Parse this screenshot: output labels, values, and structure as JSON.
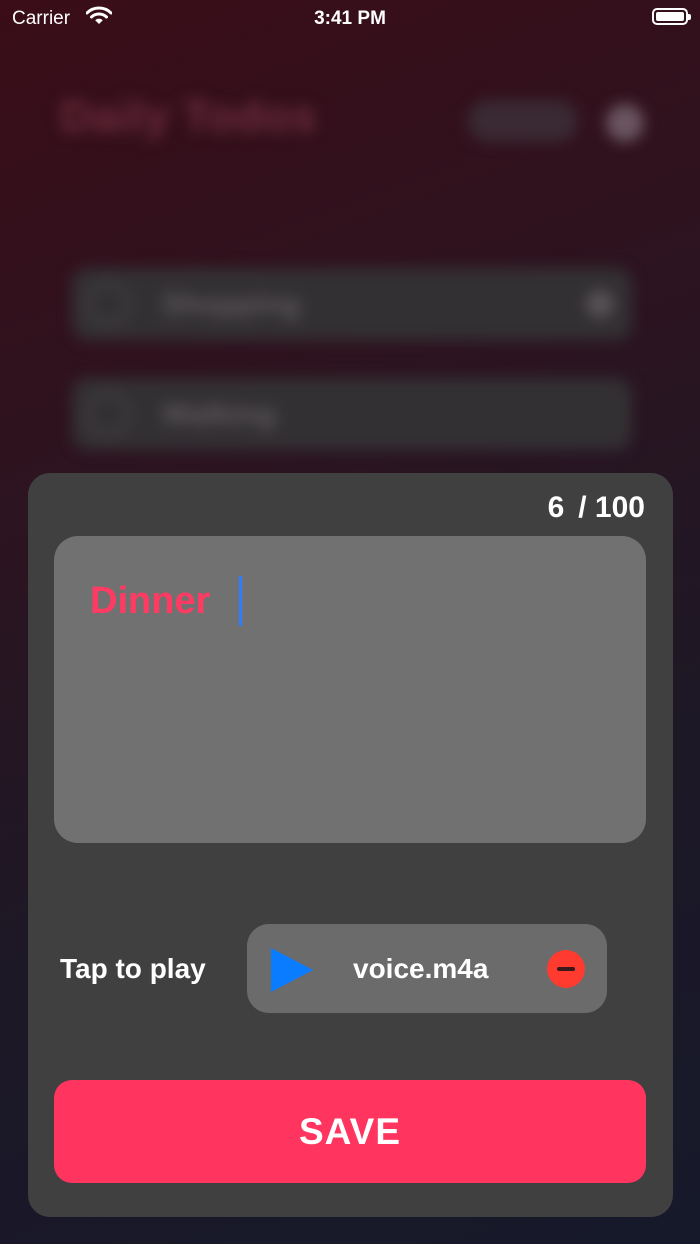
{
  "status_bar": {
    "carrier": "Carrier",
    "time": "3:41 PM",
    "battery_level": 1.0
  },
  "background": {
    "title": "Daily Todos",
    "rows": [
      {
        "label": "Shopping"
      },
      {
        "label": "Walking"
      }
    ]
  },
  "sheet": {
    "counter_current": "6",
    "counter_max": "/ 100",
    "note_text": "Dinner",
    "tap_label": "Tap to play",
    "audio_file": "voice.m4a",
    "save_label": "SAVE"
  },
  "colors": {
    "accent": "#ff3560",
    "text_accent": "#ff3a63",
    "play": "#0a7cff",
    "remove": "#ff3b30"
  },
  "icons": {
    "play": "play-icon",
    "remove": "minus-circle-icon",
    "wifi": "wifi-icon",
    "battery": "battery-icon"
  }
}
